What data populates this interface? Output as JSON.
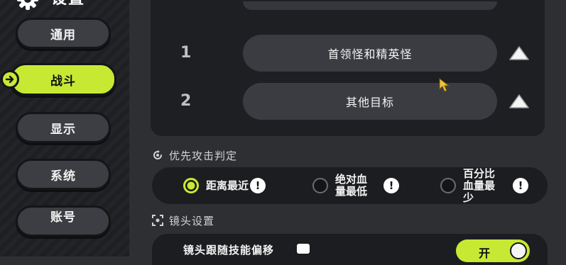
{
  "header": {
    "title": "设置"
  },
  "sidebar": {
    "items": [
      {
        "label": "通用",
        "active": false
      },
      {
        "label": "战斗",
        "active": true
      },
      {
        "label": "显示",
        "active": false
      },
      {
        "label": "系统",
        "active": false
      },
      {
        "label": "账号",
        "active": false
      }
    ]
  },
  "priority": {
    "rows": [
      {
        "index": "1",
        "label": "首领怪和精英怪"
      },
      {
        "index": "2",
        "label": "其他目标"
      }
    ]
  },
  "attack_priority": {
    "title": "优先攻击判定",
    "options": [
      {
        "label": "距离最近",
        "checked": true
      },
      {
        "label": "绝对血量最低",
        "checked": false
      },
      {
        "label": "百分比血量最少",
        "checked": false
      }
    ]
  },
  "camera": {
    "title": "镜头设置",
    "row_label": "镜头跟随技能偏移",
    "toggle_label": "开",
    "toggle_on": true
  },
  "colors": {
    "accent": "#c8e934",
    "panel": "#1e1f22",
    "background": "#2d2f33"
  },
  "icons": {
    "header": "gear-icon",
    "nav_arrow": "arrow-right-icon",
    "move_up": "triangle-up-icon",
    "section_attack": "target-refresh-icon",
    "section_camera": "focus-icon",
    "info": "exclamation-icon"
  }
}
